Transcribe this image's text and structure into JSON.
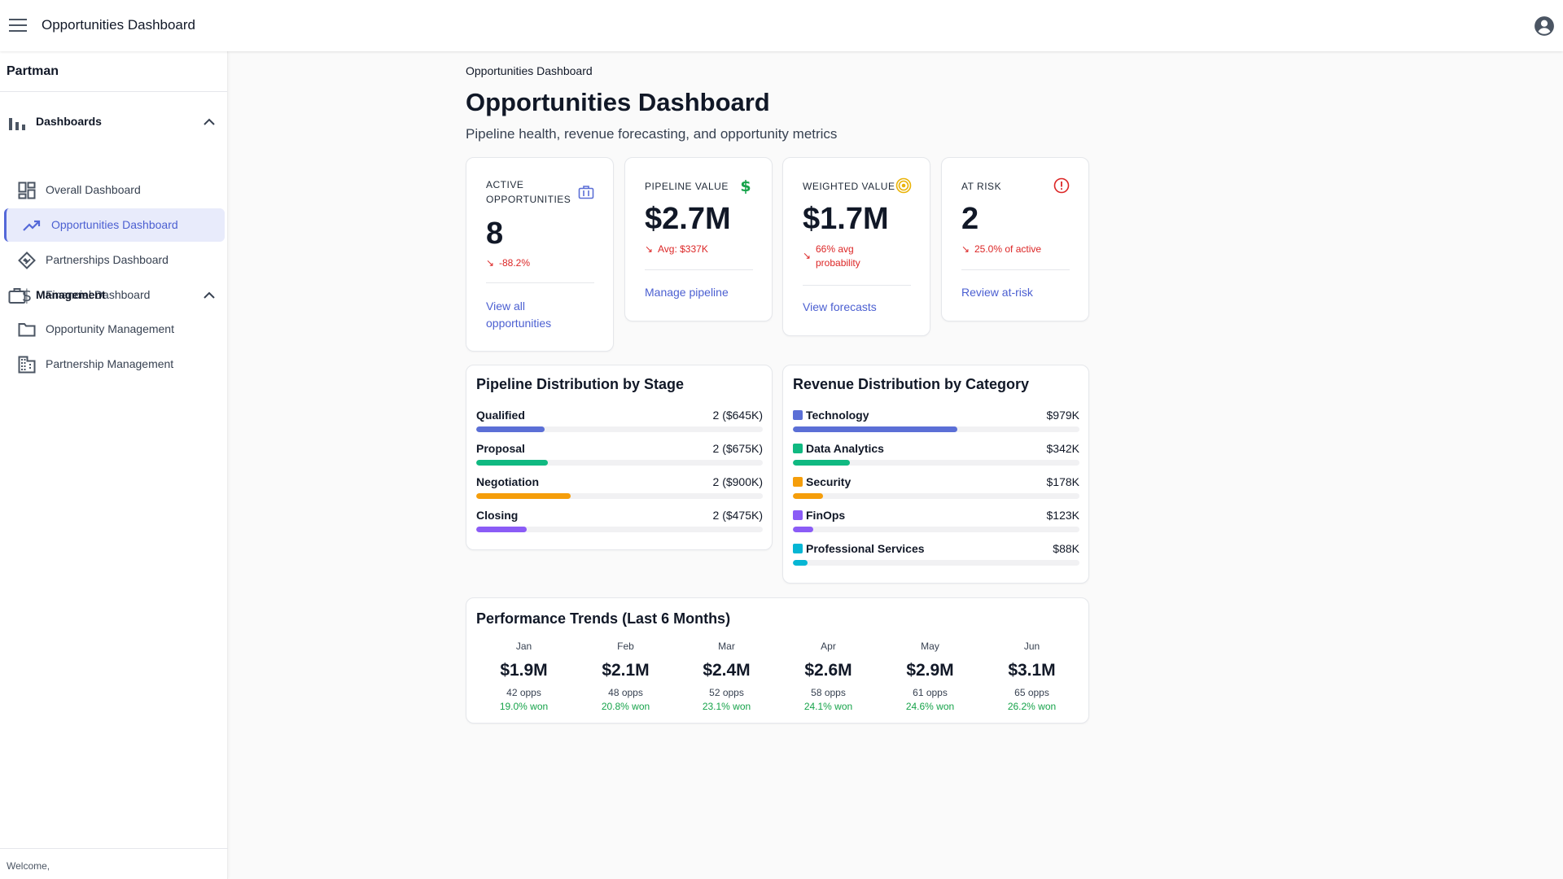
{
  "app": {
    "title": "Opportunities Dashboard"
  },
  "sidebar": {
    "brand": "Partman",
    "sections": [
      {
        "label": "Dashboards",
        "icon": "bar-chart-icon",
        "items": [
          {
            "label": "Overall Dashboard",
            "icon": "dashboard-grid-icon"
          },
          {
            "label": "Opportunities Dashboard",
            "icon": "trending-up-icon",
            "active": true
          },
          {
            "label": "Partnerships Dashboard",
            "icon": "handshake-icon"
          },
          {
            "label": "Financial Dashboard",
            "icon": "dollar-icon"
          }
        ]
      },
      {
        "label": "Management",
        "icon": "briefcase-icon",
        "items": [
          {
            "label": "Opportunity Management",
            "icon": "folder-icon"
          },
          {
            "label": "Partnership Management",
            "icon": "building-icon"
          }
        ]
      }
    ],
    "footer": "Welcome,"
  },
  "page": {
    "breadcrumb": "Opportunities Dashboard",
    "title": "Opportunities Dashboard",
    "subtitle": "Pipeline health, revenue forecasting, and opportunity metrics"
  },
  "kpis": [
    {
      "label": "Active Opportunities",
      "value": "8",
      "delta": "-88.2%",
      "link": "View all opportunities",
      "icon": "briefcase-icon",
      "icon_color": "#5b6fd6"
    },
    {
      "label": "Pipeline Value",
      "value": "$2.7M",
      "delta": "Avg: $337K",
      "link": "Manage pipeline",
      "icon": "dollar-icon",
      "icon_color": "#16a34a"
    },
    {
      "label": "Weighted Value",
      "value": "$1.7M",
      "delta": "66% avg probability",
      "link": "View forecasts",
      "icon": "target-icon",
      "icon_color": "#eab308"
    },
    {
      "label": "At Risk",
      "value": "2",
      "delta": "25.0% of active",
      "link": "Review at-risk",
      "icon": "alert-circle-icon",
      "icon_color": "#dc2626"
    }
  ],
  "pipeline": {
    "title": "Pipeline Distribution by Stage",
    "rows": [
      {
        "label": "Qualified",
        "value": "2 ($645K)",
        "fraction": 0.24,
        "color": "#5b6fd6"
      },
      {
        "label": "Proposal",
        "value": "2 ($675K)",
        "fraction": 0.25,
        "color": "#10b981"
      },
      {
        "label": "Negotiation",
        "value": "2 ($900K)",
        "fraction": 0.33,
        "color": "#f59e0b"
      },
      {
        "label": "Closing",
        "value": "2 ($475K)",
        "fraction": 0.175,
        "color": "#8b5cf6"
      }
    ]
  },
  "revenue": {
    "title": "Revenue Distribution by Category",
    "rows": [
      {
        "label": "Technology",
        "value": "$979K",
        "fraction": 0.573,
        "color": "#5b6fd6"
      },
      {
        "label": "Data Analytics",
        "value": "$342K",
        "fraction": 0.2,
        "color": "#10b981"
      },
      {
        "label": "Security",
        "value": "$178K",
        "fraction": 0.104,
        "color": "#f59e0b"
      },
      {
        "label": "FinOps",
        "value": "$123K",
        "fraction": 0.072,
        "color": "#8b5cf6"
      },
      {
        "label": "Professional Services",
        "value": "$88K",
        "fraction": 0.051,
        "color": "#06b6d4"
      }
    ]
  },
  "trends": {
    "title": "Performance Trends (Last 6 Months)",
    "months": [
      {
        "month": "Jan",
        "value": "$1.9M",
        "opps": "42 opps",
        "won": "19.0% won"
      },
      {
        "month": "Feb",
        "value": "$2.1M",
        "opps": "48 opps",
        "won": "20.8% won"
      },
      {
        "month": "Mar",
        "value": "$2.4M",
        "opps": "52 opps",
        "won": "23.1% won"
      },
      {
        "month": "Apr",
        "value": "$2.6M",
        "opps": "58 opps",
        "won": "24.1% won"
      },
      {
        "month": "May",
        "value": "$2.9M",
        "opps": "61 opps",
        "won": "24.6% won"
      },
      {
        "month": "Jun",
        "value": "$3.1M",
        "opps": "65 opps",
        "won": "26.2% won"
      }
    ]
  }
}
